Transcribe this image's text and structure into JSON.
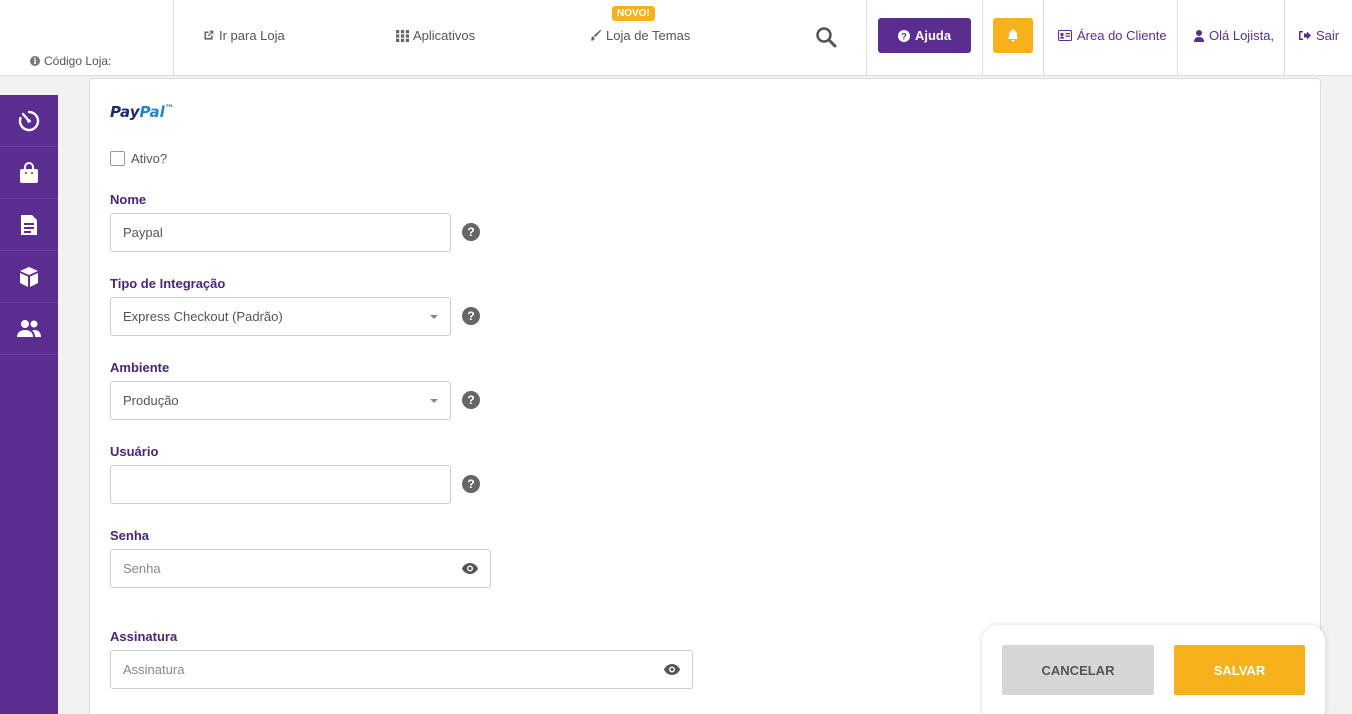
{
  "header": {
    "store_code_label": "Código Loja:",
    "go_to_store": "Ir para Loja",
    "apps": "Aplicativos",
    "theme_store": "Loja de Temas",
    "new_badge": "NOVO!",
    "help": "Ajuda",
    "client_area": "Área do Cliente",
    "greeting": "Olá Lojista,",
    "logout": "Sair"
  },
  "sidebar": {
    "items": [
      {
        "icon": "dashboard-timer-icon"
      },
      {
        "icon": "shopping-bag-icon"
      },
      {
        "icon": "document-icon"
      },
      {
        "icon": "box-icon"
      },
      {
        "icon": "users-icon"
      }
    ]
  },
  "form": {
    "logo_pay": "Pay",
    "logo_pal": "Pal",
    "logo_sup": "™",
    "active_label": "Ativo?",
    "name_label": "Nome",
    "name_value": "Paypal",
    "integration_label": "Tipo de Integração",
    "integration_value": "Express Checkout (Padrão)",
    "environment_label": "Ambiente",
    "environment_value": "Produção",
    "user_label": "Usuário",
    "user_value": "",
    "password_label": "Senha",
    "password_placeholder": "Senha",
    "signature_label": "Assinatura",
    "signature_placeholder": "Assinatura"
  },
  "actions": {
    "cancel": "CANCELAR",
    "save": "SALVAR"
  },
  "colors": {
    "brand_purple": "#5b2d91",
    "accent_yellow": "#f7b21b"
  }
}
